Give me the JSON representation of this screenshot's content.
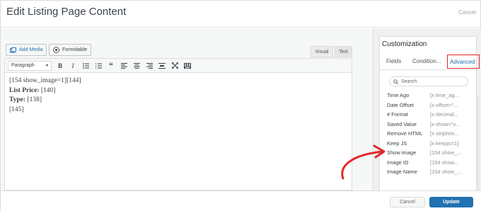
{
  "dialog": {
    "title": "Edit Listing Page Content",
    "cancel_label": "Cancel"
  },
  "media": {
    "add_media": "Add Media",
    "formidable": "Formidable"
  },
  "editor_tabs": {
    "visual": "Visual",
    "text": "Text"
  },
  "toolbar": {
    "format_value": "Paragraph",
    "buttons": [
      "bold",
      "italic",
      "bullet-list",
      "numbered-list",
      "blockquote",
      "align-left",
      "align-center",
      "align-right",
      "insert-link",
      "fullscreen",
      "toolbar-toggle"
    ]
  },
  "content": {
    "line1": "[154 show_image=1][144]",
    "price_label": "List Price:",
    "price_value": " [140]",
    "type_label": "Type:",
    "type_value": " [138]",
    "line4": "[145]"
  },
  "panel": {
    "title": "Customization",
    "tabs": {
      "fields": "Fields",
      "conditions": "Condition...",
      "advanced": "Advanced"
    },
    "search_placeholder": "Search",
    "rows": [
      {
        "name": "Time Ago",
        "code": "[x time_ag..."
      },
      {
        "name": "Date Offset",
        "code": "[x offset=\"..."
      },
      {
        "name": "# Format",
        "code": "[x decimal..."
      },
      {
        "name": "Saved Value",
        "code": "[x show=\"v..."
      },
      {
        "name": "Remove HTML",
        "code": "[x striphtm..."
      },
      {
        "name": "Keep JS",
        "code": "[x keepjs=1]"
      },
      {
        "name": "Show image",
        "code": "[154 show_..."
      },
      {
        "name": "Image ID",
        "code": "[154 show..."
      },
      {
        "name": "Image Name",
        "code": "[154 show_..."
      }
    ]
  },
  "footer": {
    "cancel_label": "Cancel",
    "update_label": "Update"
  },
  "colors": {
    "accent": "#2271b1",
    "highlight_border": "#e0282a",
    "arrow": "#e0282a"
  }
}
